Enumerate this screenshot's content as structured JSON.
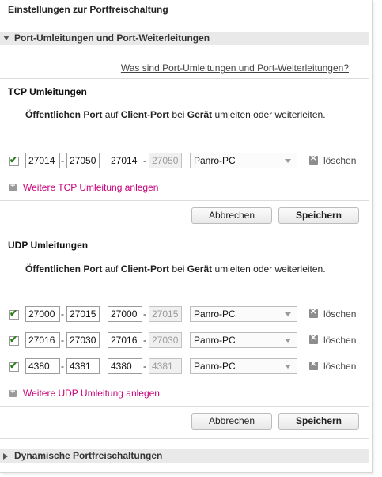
{
  "page_title": "Einstellungen zur Portfreischaltung",
  "section_forwarding": {
    "label": "Port-Umleitungen und Port-Weiterleitungen"
  },
  "help_link": "Was sind Port-Umleitungen und Port-Weiterleitungen?",
  "tcp": {
    "heading": "TCP Umleitungen",
    "desc": {
      "p1": "Öffentlichen Port",
      "w1": "auf",
      "p2": "Client-Port",
      "w2": "bei",
      "p3": "Gerät",
      "w3": "umleiten oder weiterleiten."
    },
    "rows": [
      {
        "checked": true,
        "pub_from": "27014",
        "pub_to": "27050",
        "client_from": "27014",
        "client_to": "27050",
        "device": "Panro-PC",
        "delete_label": "löschen"
      }
    ],
    "add_label": "Weitere TCP Umleitung anlegen",
    "cancel_label": "Abbrechen",
    "save_label": "Speichern"
  },
  "udp": {
    "heading": "UDP Umleitungen",
    "desc": {
      "p1": "Öffentlichen Port",
      "w1": "auf",
      "p2": "Client-Port",
      "w2": "bei",
      "p3": "Gerät",
      "w3": "umleiten oder weiterleiten."
    },
    "rows": [
      {
        "checked": true,
        "pub_from": "27000",
        "pub_to": "27015",
        "client_from": "27000",
        "client_to": "27015",
        "device": "Panro-PC",
        "delete_label": "löschen"
      },
      {
        "checked": true,
        "pub_from": "27016",
        "pub_to": "27030",
        "client_from": "27016",
        "client_to": "27030",
        "device": "Panro-PC",
        "delete_label": "löschen"
      },
      {
        "checked": true,
        "pub_from": "4380",
        "pub_to": "4381",
        "client_from": "4380",
        "client_to": "4381",
        "device": "Panro-PC",
        "delete_label": "löschen"
      }
    ],
    "add_label": "Weitere UDP Umleitung anlegen",
    "cancel_label": "Abbrechen",
    "save_label": "Speichern"
  },
  "section_dynamic": {
    "label": "Dynamische Portfreischaltungen"
  },
  "icons": {
    "checkbox": "checkbox-checked-icon",
    "delete": "delete-x-icon",
    "add": "plus-icon",
    "expand": "triangle-icon",
    "dropdown": "chevron-down-icon"
  }
}
